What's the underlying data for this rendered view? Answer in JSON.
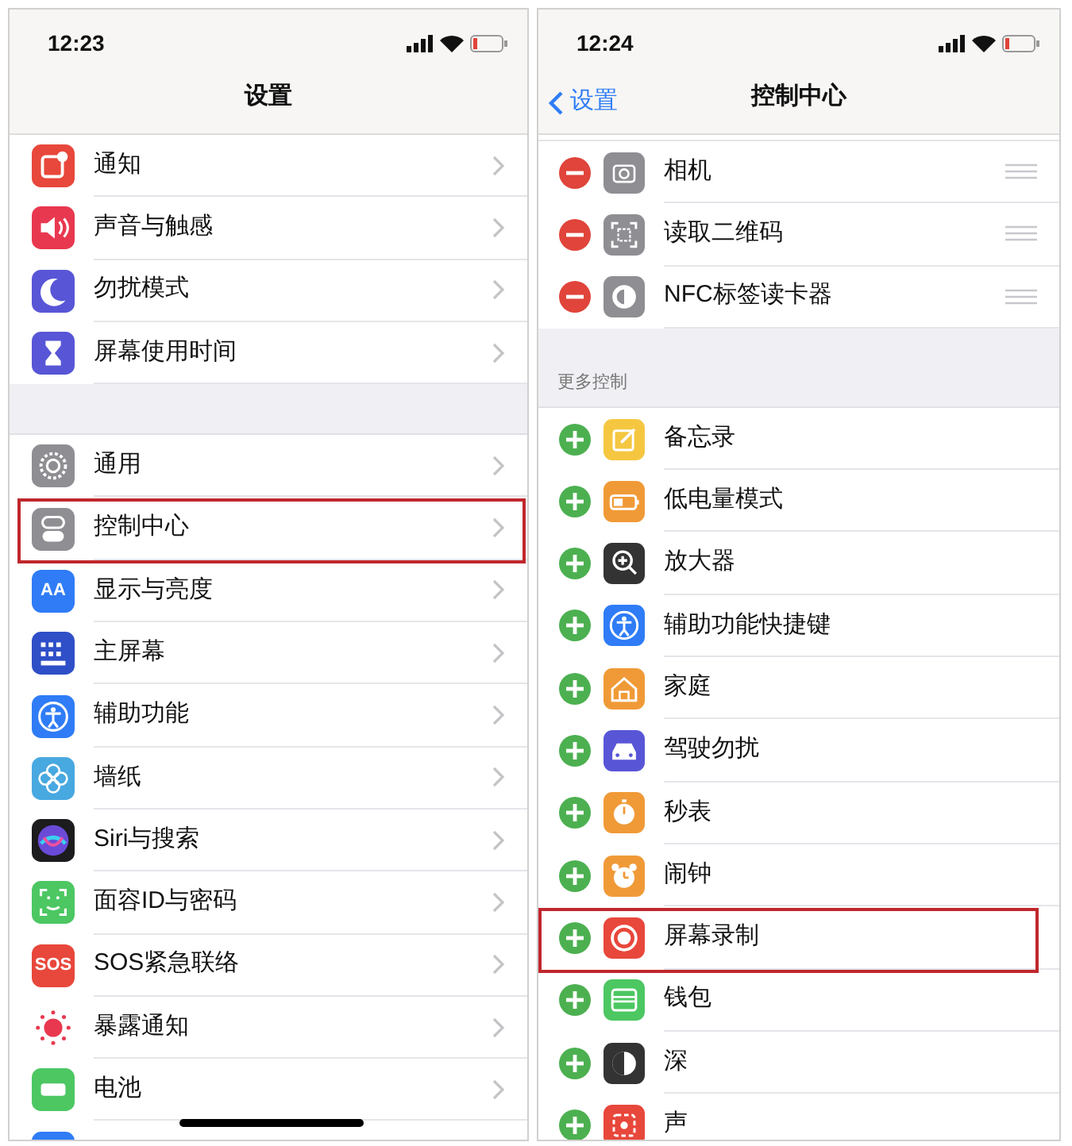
{
  "screens": [
    {
      "status_bar": {
        "time": "12:23"
      },
      "nav_bar": {
        "title": "设置"
      },
      "sections": [
        {
          "rows": [
            {
              "label": "通知",
              "kind": "link",
              "highlighted": false
            },
            {
              "label": "声音与触感",
              "kind": "link",
              "highlighted": false
            },
            {
              "label": "勿扰模式",
              "kind": "link",
              "highlighted": false
            },
            {
              "label": "屏幕使用时间",
              "kind": "link",
              "highlighted": false
            }
          ]
        },
        {
          "rows": [
            {
              "label": "通用",
              "kind": "link",
              "highlighted": false
            },
            {
              "label": "控制中心",
              "kind": "link",
              "highlighted": true
            },
            {
              "label": "显示与亮度",
              "kind": "link",
              "highlighted": false,
              "icon_text": "AA"
            },
            {
              "label": "主屏幕",
              "kind": "link",
              "highlighted": false
            },
            {
              "label": "辅助功能",
              "kind": "link",
              "highlighted": false
            },
            {
              "label": "墙纸",
              "kind": "link",
              "highlighted": false
            },
            {
              "label": "Siri与搜索",
              "kind": "link",
              "highlighted": false
            },
            {
              "label": "面容ID与密码",
              "kind": "link",
              "highlighted": false
            },
            {
              "label": "SOS紧急联络",
              "kind": "link",
              "highlighted": false,
              "icon_text": "SOS"
            },
            {
              "label": "暴露通知",
              "kind": "link",
              "highlighted": false
            },
            {
              "label": "电池",
              "kind": "link",
              "highlighted": false
            }
          ]
        }
      ]
    },
    {
      "status_bar": {
        "time": "12:24"
      },
      "nav_bar": {
        "back": "设置",
        "title": "控制中心"
      },
      "sections": [
        {
          "rows": [
            {
              "label": "相机",
              "kind": "included",
              "highlighted": false
            },
            {
              "label": "读取二维码",
              "kind": "included",
              "highlighted": false
            },
            {
              "label": "NFC标签读卡器",
              "kind": "included",
              "highlighted": false
            }
          ]
        },
        {
          "header": "更多控制",
          "rows": [
            {
              "label": "备忘录",
              "kind": "more",
              "highlighted": false
            },
            {
              "label": "低电量模式",
              "kind": "more",
              "highlighted": false
            },
            {
              "label": "放大器",
              "kind": "more",
              "highlighted": false
            },
            {
              "label": "辅助功能快捷键",
              "kind": "more",
              "highlighted": false
            },
            {
              "label": "家庭",
              "kind": "more",
              "highlighted": false
            },
            {
              "label": "驾驶勿扰",
              "kind": "more",
              "highlighted": false
            },
            {
              "label": "秒表",
              "kind": "more",
              "highlighted": false
            },
            {
              "label": "闹钟",
              "kind": "more",
              "highlighted": false
            },
            {
              "label": "屏幕录制",
              "kind": "more",
              "highlighted": true
            },
            {
              "label": "钱包",
              "kind": "more",
              "highlighted": false
            },
            {
              "label": "深",
              "kind": "more",
              "highlighted": false
            },
            {
              "label": "声",
              "kind": "more",
              "highlighted": false
            }
          ]
        }
      ]
    }
  ]
}
